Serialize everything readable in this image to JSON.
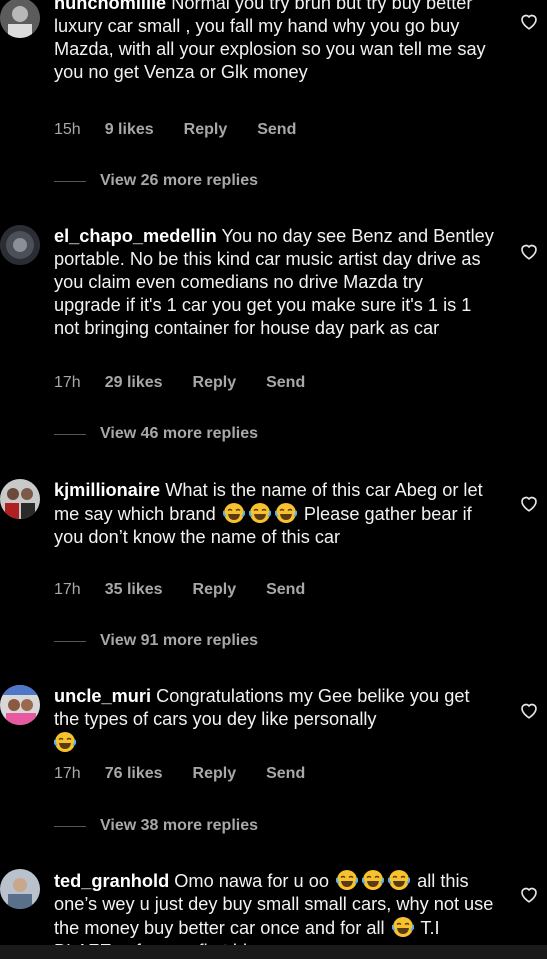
{
  "comments": [
    {
      "username": "nunchomillie",
      "text": "Normal you try brun but try buy better luxury car small , you fall my hand why you go buy Mazda, with all your explosion so you wan tell me say you no get Venza or Glk money",
      "time": "15h",
      "likes": "9 likes",
      "reply": "Reply",
      "send": "Send",
      "more_replies": "View 26 more replies"
    },
    {
      "username": "el_chapo_medellin",
      "text": "You no day see Benz and Bentley portable. No be this kind car music artist day drive as you claim even comedians no drive Mazda try upgrade if it's 1 car you get you make sure it's 1 is 1 not bringing container for house day park as car",
      "time": "17h",
      "likes": "29 likes",
      "reply": "Reply",
      "send": "Send",
      "more_replies": "View 46 more replies"
    },
    {
      "username": "kjmillionaire",
      "text_a": "What is the name of this car Abeg or let me say which brand",
      "text_b": "Please gather bear if you don’t know the name of this car",
      "time": "17h",
      "likes": "35 likes",
      "reply": "Reply",
      "send": "Send",
      "more_replies": "View 91 more replies"
    },
    {
      "username": "uncle_muri",
      "text": "Congratulations my Gee belike you get the types of cars you dey like personally",
      "time": "17h",
      "likes": "76 likes",
      "reply": "Reply",
      "send": "Send",
      "more_replies": "View 38 more replies"
    },
    {
      "username": "ted_granhold",
      "text_a": "Omo nawa for u oo",
      "text_b": "all this one’s wey u just dey buy small small cars, why not use the money buy better car once and for all",
      "text_c": "T.I BLAZE sef wey u first blow"
    }
  ],
  "icons": {
    "like": "heart-outline-icon",
    "emoji": "face-with-tears-of-joy-icon"
  },
  "colors": {
    "background": "#000000",
    "text": "#f2f2f2",
    "meta": "#a8a8a8",
    "emoji": "#f7c22e"
  }
}
